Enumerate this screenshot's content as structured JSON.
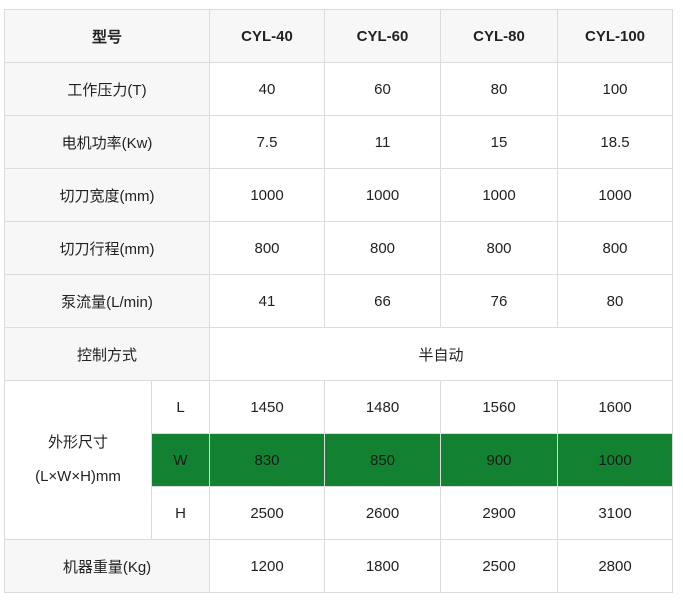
{
  "header": {
    "model_label": "型号",
    "models": [
      "CYL-40",
      "CYL-60",
      "CYL-80",
      "CYL-100"
    ]
  },
  "rows": [
    {
      "label": "工作压力(T)",
      "values": [
        "40",
        "60",
        "80",
        "100"
      ]
    },
    {
      "label": "电机功率(Kw)",
      "values": [
        "7.5",
        "11",
        "15",
        "18.5"
      ]
    },
    {
      "label": "切刀宽度(mm)",
      "values": [
        "1000",
        "1000",
        "1000",
        "1000"
      ]
    },
    {
      "label": "切刀行程(mm)",
      "values": [
        "800",
        "800",
        "800",
        "800"
      ]
    },
    {
      "label": "泵流量(L/min)",
      "values": [
        "41",
        "66",
        "76",
        "80"
      ]
    }
  ],
  "control": {
    "label": "控制方式",
    "value": "半自动"
  },
  "dimensions": {
    "label_line1": "外形尺寸",
    "label_line2": "(L×W×H)mm",
    "rows": [
      {
        "axis": "L",
        "values": [
          "1450",
          "1480",
          "1560",
          "1600"
        ]
      },
      {
        "axis": "W",
        "values": [
          "830",
          "850",
          "900",
          "1000"
        ]
      },
      {
        "axis": "H",
        "values": [
          "2500",
          "2600",
          "2900",
          "3100"
        ]
      }
    ]
  },
  "weight": {
    "label": "机器重量(Kg)",
    "values": [
      "1200",
      "1800",
      "2500",
      "2800"
    ]
  },
  "colors": {
    "highlight_row": "#128232",
    "label_bg": "#f7f7f7",
    "border": "#dcdcdc"
  }
}
